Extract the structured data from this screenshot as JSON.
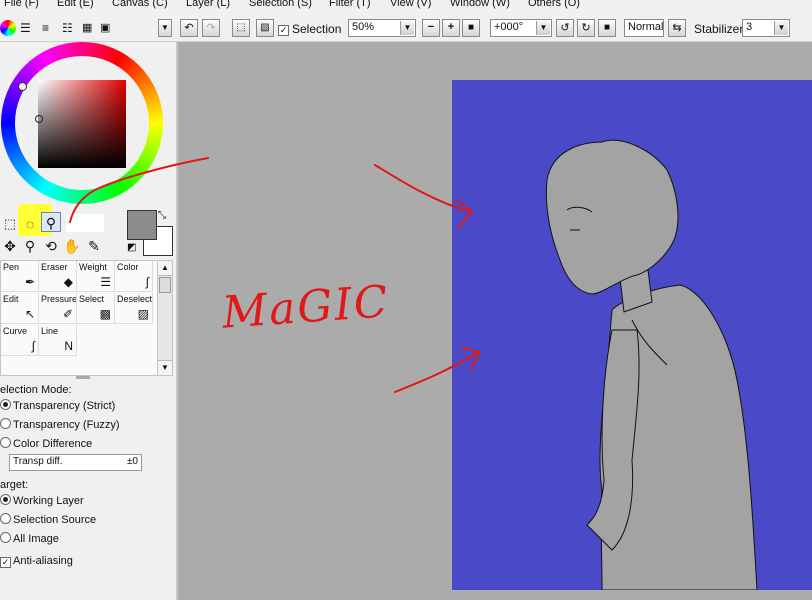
{
  "menu": [
    "File (F)",
    "Edit (E)",
    "Canvas (C)",
    "Layer (L)",
    "Selection (S)",
    "Filter (T)",
    "View (V)",
    "Window (W)",
    "Others (O)"
  ],
  "toolbar": {
    "selection_label": "Selection",
    "selection_checked": true,
    "zoom": "50%",
    "rotation": "+000°",
    "blend_mode": "Normal",
    "stabilizer_label": "Stabilizer",
    "stabilizer_value": "3"
  },
  "brushes": [
    {
      "label": "Pen",
      "icon": "pen-icon"
    },
    {
      "label": "Eraser",
      "icon": "eraser-icon"
    },
    {
      "label": "Weight",
      "icon": "weight-icon"
    },
    {
      "label": "Color",
      "icon": "color-icon"
    },
    {
      "label": "Edit",
      "icon": "edit-icon"
    },
    {
      "label": "Pressure",
      "icon": "pressure-icon"
    },
    {
      "label": "Select",
      "icon": "select-icon"
    },
    {
      "label": "Deselect",
      "icon": "deselect-icon"
    },
    {
      "label": "Curve",
      "icon": "curve-icon"
    },
    {
      "label": "Line",
      "icon": "line-icon"
    }
  ],
  "options": {
    "selection_mode_title": "election Mode:",
    "modes": [
      "Transparency (Strict)",
      "Transparency (Fuzzy)",
      "Color Difference"
    ],
    "selected_mode": 0,
    "transp_diff_label": "Transp diff.",
    "transp_diff_value": "±0",
    "target_title": "arget:",
    "targets": [
      "Working Layer",
      "Selection Source",
      "All Image"
    ],
    "selected_target": 0,
    "antialias_label": "Anti-aliasing",
    "antialias_checked": true
  },
  "annotation_text": "MaGIC",
  "colors": {
    "artboard": "#4a4ac8",
    "canvas_bg": "#ababab",
    "highlight": "#ffff33",
    "annotation": "#e01818",
    "main_color": "#8c8c8c",
    "sub_color": "#ffffff"
  }
}
